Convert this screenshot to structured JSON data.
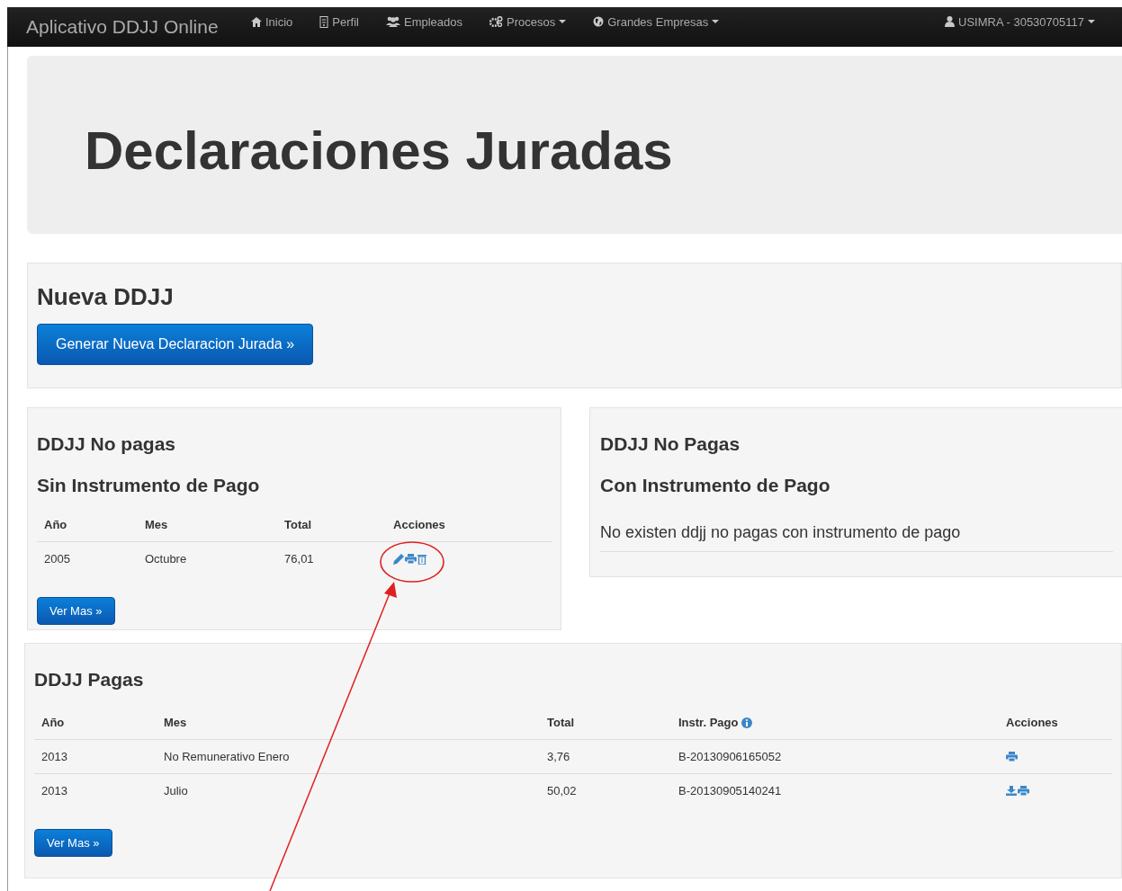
{
  "navbar": {
    "brand": "Aplicativo DDJJ Online",
    "items": [
      {
        "kind": "home",
        "label": "Inicio",
        "dropdown": false
      },
      {
        "kind": "file",
        "label": "Perfil",
        "dropdown": false
      },
      {
        "kind": "users",
        "label": "Empleados",
        "dropdown": false
      },
      {
        "kind": "cogs",
        "label": "Procesos",
        "dropdown": true
      },
      {
        "kind": "globe",
        "label": "Grandes Empresas",
        "dropdown": true
      }
    ],
    "user": {
      "kind": "user",
      "label": "USIMRA - 30530705117",
      "dropdown": true
    }
  },
  "jumbotron": {
    "title": "Declaraciones Juradas"
  },
  "nueva": {
    "title": "Nueva DDJJ",
    "button": "Generar Nueva Declaracion Jurada »"
  },
  "no_pagas_sin": {
    "title": "DDJJ No pagas",
    "subtitle": "Sin Instrumento de Pago",
    "columns": [
      "Año",
      "Mes",
      "Total",
      "Acciones"
    ],
    "rows": [
      {
        "cells": [
          "2005",
          "Octubre",
          "76,01"
        ],
        "actions": [
          {
            "kind": "edit"
          },
          {
            "kind": "print"
          },
          {
            "kind": "delete"
          }
        ]
      }
    ],
    "button": "Ver Mas »"
  },
  "no_pagas_con": {
    "title": "DDJJ No Pagas",
    "subtitle": "Con Instrumento de Pago",
    "message": "No existen ddjj no pagas con instrumento de pago"
  },
  "pagas": {
    "title": "DDJJ Pagas",
    "columns": [
      {
        "label": "Año",
        "info": false
      },
      {
        "label": "Mes",
        "info": false
      },
      {
        "label": "Total",
        "info": false
      },
      {
        "label": "Instr. Pago",
        "info": true
      },
      {
        "label": "Acciones",
        "info": false
      }
    ],
    "rows": [
      {
        "cells": [
          "2013",
          "No Remunerativo Enero",
          "3,76",
          "B-20130906165052"
        ],
        "actions": [
          {
            "kind": "print"
          }
        ]
      },
      {
        "cells": [
          "2013",
          "Julio",
          "50,02",
          "B-20130905140241"
        ],
        "actions": [
          {
            "kind": "download"
          },
          {
            "kind": "print"
          }
        ]
      }
    ],
    "button": "Ver Mas »"
  }
}
